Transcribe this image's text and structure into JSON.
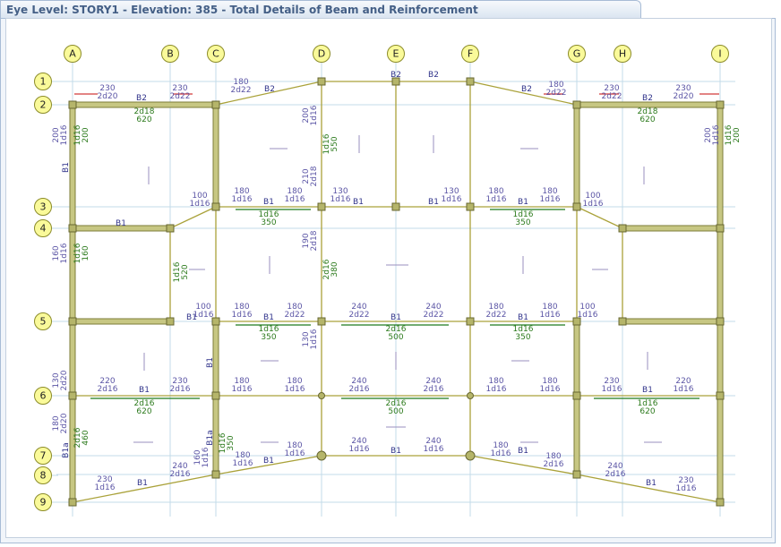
{
  "window": {
    "title": "Eye Level: STORY1 - Elevation: 385 - Total Details of Beam and Reinforcement"
  },
  "colors": {
    "grid": "#c3dbe8",
    "beam": "#aaa23a",
    "column": "#b5b56a",
    "bubble": "#fafa9a",
    "label_purple": "#5b55a5",
    "label_green": "#2c7a1c",
    "beam_name": "#30338a"
  },
  "grid": {
    "columns": [
      "A",
      "B",
      "C",
      "D",
      "E",
      "F",
      "G",
      "H",
      "I"
    ],
    "rows": [
      "1",
      "2",
      "3",
      "4",
      "5",
      "6",
      "7",
      "8",
      "9"
    ]
  },
  "beam_labels": [
    {
      "t": "B2",
      "c": "bname"
    },
    {
      "t": "B2",
      "c": "bname"
    },
    {
      "t": "B2",
      "c": "bname"
    },
    {
      "t": "B2",
      "c": "bname"
    },
    {
      "t": "B2",
      "c": "bname"
    },
    {
      "t": "B2",
      "c": "bname"
    },
    {
      "t": "230",
      "c": "purple"
    },
    {
      "t": "2d20",
      "c": "purple"
    },
    {
      "t": "230",
      "c": "purple"
    },
    {
      "t": "2d22",
      "c": "purple"
    },
    {
      "t": "180",
      "c": "purple"
    },
    {
      "t": "2d22",
      "c": "purple"
    },
    {
      "t": "180",
      "c": "purple"
    },
    {
      "t": "2d22",
      "c": "purple"
    },
    {
      "t": "230",
      "c": "purple"
    },
    {
      "t": "2d22",
      "c": "purple"
    },
    {
      "t": "230",
      "c": "purple"
    },
    {
      "t": "2d20",
      "c": "purple"
    },
    {
      "t": "2d18",
      "c": "green"
    },
    {
      "t": "620",
      "c": "green"
    },
    {
      "t": "2d18",
      "c": "green"
    },
    {
      "t": "620",
      "c": "green"
    },
    {
      "t": "B1",
      "c": "bname"
    },
    {
      "t": "B1",
      "c": "bname"
    },
    {
      "t": "B1",
      "c": "bname"
    },
    {
      "t": "B1",
      "c": "bname"
    },
    {
      "t": "180",
      "c": "purple"
    },
    {
      "t": "1d16",
      "c": "purple"
    },
    {
      "t": "180",
      "c": "purple"
    },
    {
      "t": "1d16",
      "c": "purple"
    },
    {
      "t": "130",
      "c": "purple"
    },
    {
      "t": "1d16",
      "c": "purple"
    },
    {
      "t": "130",
      "c": "purple"
    },
    {
      "t": "1d16",
      "c": "purple"
    },
    {
      "t": "180",
      "c": "purple"
    },
    {
      "t": "1d16",
      "c": "purple"
    },
    {
      "t": "180",
      "c": "purple"
    },
    {
      "t": "1d16",
      "c": "purple"
    },
    {
      "t": "100",
      "c": "purple"
    },
    {
      "t": "1d16",
      "c": "purple"
    },
    {
      "t": "100",
      "c": "purple"
    },
    {
      "t": "1d16",
      "c": "purple"
    },
    {
      "t": "1d16",
      "c": "green"
    },
    {
      "t": "350",
      "c": "green"
    },
    {
      "t": "1d16",
      "c": "green"
    },
    {
      "t": "350",
      "c": "green"
    },
    {
      "t": "B1",
      "c": "bname"
    },
    {
      "t": "B1",
      "c": "bname"
    },
    {
      "t": "B1",
      "c": "bname"
    },
    {
      "t": "B1",
      "c": "bname"
    },
    {
      "t": "B1",
      "c": "bname"
    },
    {
      "t": "100",
      "c": "purple"
    },
    {
      "t": "1d16",
      "c": "purple"
    },
    {
      "t": "180",
      "c": "purple"
    },
    {
      "t": "1d16",
      "c": "purple"
    },
    {
      "t": "180",
      "c": "purple"
    },
    {
      "t": "2d22",
      "c": "purple"
    },
    {
      "t": "240",
      "c": "purple"
    },
    {
      "t": "2d22",
      "c": "purple"
    },
    {
      "t": "240",
      "c": "purple"
    },
    {
      "t": "2d22",
      "c": "purple"
    },
    {
      "t": "180",
      "c": "purple"
    },
    {
      "t": "2d22",
      "c": "purple"
    },
    {
      "t": "180",
      "c": "purple"
    },
    {
      "t": "1d16",
      "c": "purple"
    },
    {
      "t": "100",
      "c": "purple"
    },
    {
      "t": "1d16",
      "c": "purple"
    },
    {
      "t": "1d16",
      "c": "green"
    },
    {
      "t": "350",
      "c": "green"
    },
    {
      "t": "2d16",
      "c": "green"
    },
    {
      "t": "500",
      "c": "green"
    },
    {
      "t": "1d16",
      "c": "green"
    },
    {
      "t": "350",
      "c": "green"
    },
    {
      "t": "220",
      "c": "purple"
    },
    {
      "t": "2d16",
      "c": "purple"
    },
    {
      "t": "230",
      "c": "purple"
    },
    {
      "t": "2d16",
      "c": "purple"
    },
    {
      "t": "180",
      "c": "purple"
    },
    {
      "t": "1d16",
      "c": "purple"
    },
    {
      "t": "180",
      "c": "purple"
    },
    {
      "t": "1d16",
      "c": "purple"
    },
    {
      "t": "240",
      "c": "purple"
    },
    {
      "t": "2d16",
      "c": "purple"
    },
    {
      "t": "240",
      "c": "purple"
    },
    {
      "t": "2d16",
      "c": "purple"
    },
    {
      "t": "180",
      "c": "purple"
    },
    {
      "t": "1d16",
      "c": "purple"
    },
    {
      "t": "180",
      "c": "purple"
    },
    {
      "t": "1d16",
      "c": "purple"
    },
    {
      "t": "230",
      "c": "purple"
    },
    {
      "t": "1d16",
      "c": "purple"
    },
    {
      "t": "220",
      "c": "purple"
    },
    {
      "t": "1d16",
      "c": "purple"
    },
    {
      "t": "2d16",
      "c": "green"
    },
    {
      "t": "620",
      "c": "green"
    },
    {
      "t": "2d16",
      "c": "green"
    },
    {
      "t": "500",
      "c": "green"
    },
    {
      "t": "1d16",
      "c": "green"
    },
    {
      "t": "620",
      "c": "green"
    },
    {
      "t": "240",
      "c": "purple"
    },
    {
      "t": "1d16",
      "c": "purple"
    },
    {
      "t": "240",
      "c": "purple"
    },
    {
      "t": "1d16",
      "c": "purple"
    },
    {
      "t": "230",
      "c": "purple"
    },
    {
      "t": "1d16",
      "c": "purple"
    },
    {
      "t": "240",
      "c": "purple"
    },
    {
      "t": "2d16",
      "c": "purple"
    },
    {
      "t": "180",
      "c": "purple"
    },
    {
      "t": "1d16",
      "c": "purple"
    },
    {
      "t": "180",
      "c": "purple"
    },
    {
      "t": "1d16",
      "c": "purple"
    },
    {
      "t": "180",
      "c": "purple"
    },
    {
      "t": "1d16",
      "c": "purple"
    },
    {
      "t": "180",
      "c": "purple"
    },
    {
      "t": "2d16",
      "c": "purple"
    },
    {
      "t": "240",
      "c": "purple"
    },
    {
      "t": "2d16",
      "c": "purple"
    },
    {
      "t": "230",
      "c": "purple"
    },
    {
      "t": "1d16",
      "c": "purple"
    },
    {
      "t": "B1",
      "c": "bname"
    },
    {
      "t": "B1",
      "c": "bname"
    },
    {
      "t": "B1",
      "c": "bname"
    },
    {
      "t": "B1",
      "c": "bname"
    },
    {
      "t": "B1",
      "c": "bname"
    },
    {
      "t": "B1",
      "c": "bname"
    },
    {
      "t": "B1",
      "c": "bname"
    }
  ],
  "vertical_labels": [
    {
      "t": "200",
      "c": "purple"
    },
    {
      "t": "1d16",
      "c": "purple"
    },
    {
      "t": "1d16",
      "c": "green"
    },
    {
      "t": "200",
      "c": "green"
    },
    {
      "t": "200",
      "c": "purple"
    },
    {
      "t": "1d16",
      "c": "purple"
    },
    {
      "t": "1d16",
      "c": "green"
    },
    {
      "t": "200",
      "c": "green"
    },
    {
      "t": "B1",
      "c": "bname"
    },
    {
      "t": "160",
      "c": "purple"
    },
    {
      "t": "1d16",
      "c": "purple"
    },
    {
      "t": "1d16",
      "c": "green"
    },
    {
      "t": "160",
      "c": "green"
    },
    {
      "t": "130",
      "c": "purple"
    },
    {
      "t": "2d20",
      "c": "purple"
    },
    {
      "t": "180",
      "c": "purple"
    },
    {
      "t": "2d20",
      "c": "purple"
    },
    {
      "t": "2d16",
      "c": "green"
    },
    {
      "t": "460",
      "c": "green"
    },
    {
      "t": "B1a",
      "c": "bname"
    },
    {
      "t": "200",
      "c": "purple"
    },
    {
      "t": "1d16",
      "c": "purple"
    },
    {
      "t": "1d16",
      "c": "green"
    },
    {
      "t": "550",
      "c": "green"
    },
    {
      "t": "210",
      "c": "purple"
    },
    {
      "t": "2d18",
      "c": "purple"
    },
    {
      "t": "190",
      "c": "purple"
    },
    {
      "t": "2d18",
      "c": "purple"
    },
    {
      "t": "2d16",
      "c": "green"
    },
    {
      "t": "380",
      "c": "green"
    },
    {
      "t": "1d16",
      "c": "green"
    },
    {
      "t": "520",
      "c": "green"
    },
    {
      "t": "1d16",
      "c": "green"
    },
    {
      "t": "350",
      "c": "green"
    },
    {
      "t": "130",
      "c": "purple"
    },
    {
      "t": "1d16",
      "c": "purple"
    },
    {
      "t": "160",
      "c": "purple"
    },
    {
      "t": "1d16",
      "c": "purple"
    },
    {
      "t": "B1a",
      "c": "bname"
    },
    {
      "t": "B1",
      "c": "bname"
    }
  ]
}
